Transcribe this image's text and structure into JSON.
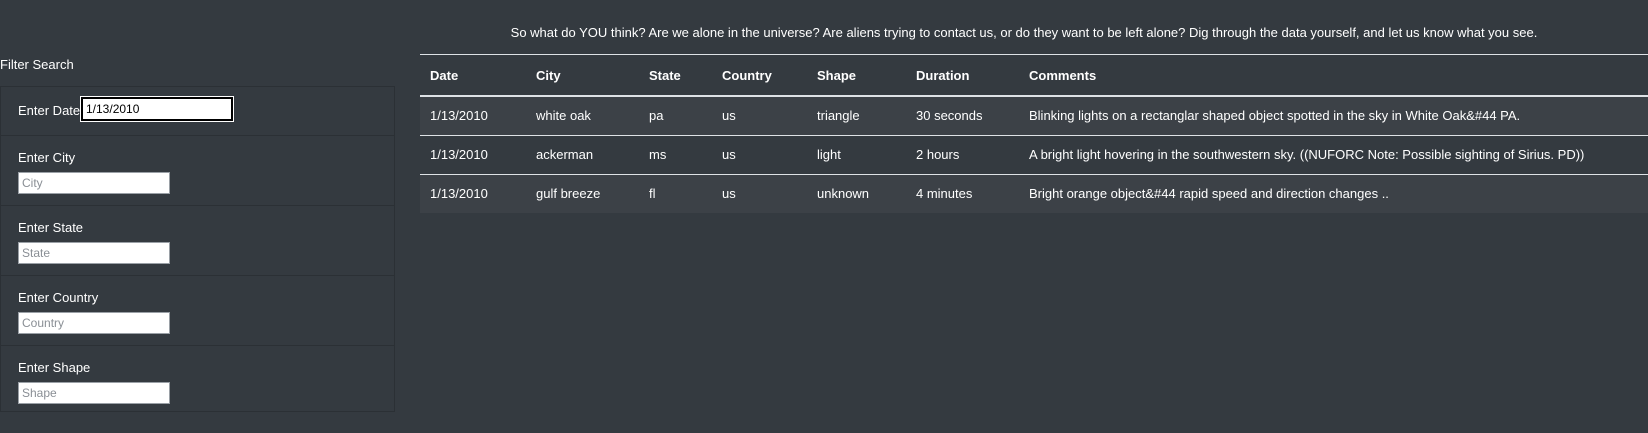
{
  "intro_text": "So what do YOU think? Are we alone in the universe? Are aliens trying to contact us, or do they want to be left alone? Dig through the data yourself, and let us know what you see.",
  "filters": {
    "title": "Filter Search",
    "date": {
      "label": "Enter Date",
      "value": "1/13/2010",
      "placeholder": ""
    },
    "city": {
      "label": "Enter City",
      "value": "",
      "placeholder": "City"
    },
    "state": {
      "label": "Enter State",
      "value": "",
      "placeholder": "State"
    },
    "country": {
      "label": "Enter Country",
      "value": "",
      "placeholder": "Country"
    },
    "shape": {
      "label": "Enter Shape",
      "value": "",
      "placeholder": "Shape"
    }
  },
  "table": {
    "headers": [
      "Date",
      "City",
      "State",
      "Country",
      "Shape",
      "Duration",
      "Comments"
    ],
    "rows": [
      [
        "1/13/2010",
        "white oak",
        "pa",
        "us",
        "triangle",
        "30 seconds",
        "Blinking lights on a rectanglar shaped object spotted in the sky in White Oak&#44 PA."
      ],
      [
        "1/13/2010",
        "ackerman",
        "ms",
        "us",
        "light",
        "2 hours",
        "A bright light hovering in the southwestern sky. ((NUFORC Note: Possible sighting of Sirius. PD))"
      ],
      [
        "1/13/2010",
        "gulf breeze",
        "fl",
        "us",
        "unknown",
        "4 minutes",
        "Bright orange object&#44 rapid speed and direction changes .."
      ]
    ]
  },
  "colors": {
    "page_background": "#343a40",
    "stripe": "#3c4147",
    "text": "#ffffff",
    "border": "#dee2e6"
  }
}
